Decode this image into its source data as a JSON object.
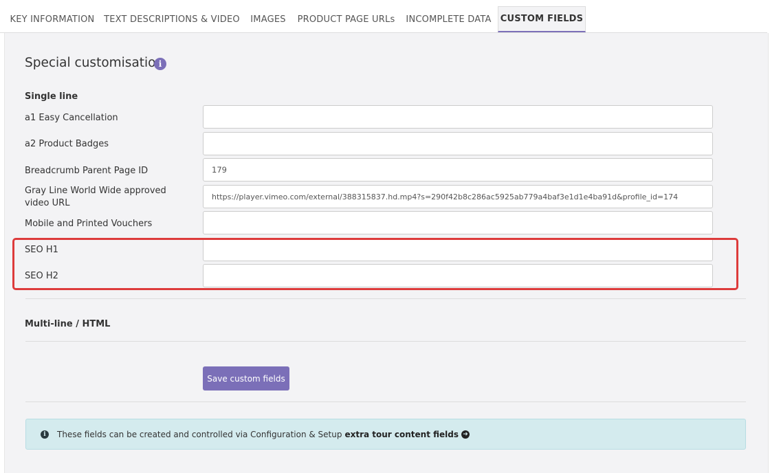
{
  "tabs": [
    {
      "label": "KEY INFORMATION"
    },
    {
      "label": "TEXT DESCRIPTIONS & VIDEO"
    },
    {
      "label": "IMAGES"
    },
    {
      "label": "PRODUCT PAGE URLs"
    },
    {
      "label": "INCOMPLETE DATA"
    },
    {
      "label": "CUSTOM FIELDS"
    }
  ],
  "active_tab": "CUSTOM FIELDS",
  "section": {
    "heading": "Special customisation",
    "info_icon_glyph": "i"
  },
  "single_line": {
    "label": "Single line",
    "fields": [
      {
        "label": "a1 Easy Cancellation",
        "value": ""
      },
      {
        "label": "a2 Product Badges",
        "value": ""
      },
      {
        "label": "Breadcrumb Parent Page ID",
        "value": "179"
      },
      {
        "label": "Gray Line World Wide approved video URL",
        "value": "https://player.vimeo.com/external/388315837.hd.mp4?s=290f42b8c286ac5925ab779a4baf3e1d1e4ba91d&profile_id=174"
      },
      {
        "label": "Mobile and Printed Vouchers",
        "value": ""
      },
      {
        "label": "SEO H1",
        "value": ""
      },
      {
        "label": "SEO H2",
        "value": ""
      }
    ]
  },
  "multi_line": {
    "label": "Multi-line / HTML"
  },
  "save_button": {
    "label": "Save custom fields"
  },
  "alert": {
    "text": "These fields can be created and controlled via Configuration & Setup",
    "link_text": "extra tour content fields",
    "link_icon": "arrow-circle-right-icon"
  },
  "colors": {
    "accent": "#7b6fb8",
    "highlight_border": "#dd3b3b",
    "alert_bg": "#d4ebee"
  }
}
